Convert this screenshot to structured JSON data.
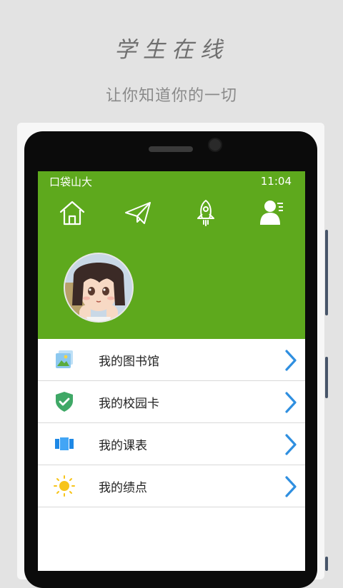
{
  "promo": {
    "title": "学生在线",
    "subtitle": "让你知道你的一切"
  },
  "status_bar": {
    "carrier": "口袋山大",
    "time": "11:04"
  },
  "nav": {
    "icons": [
      "home-icon",
      "paper-plane-icon",
      "rocket-icon",
      "user-profile-icon"
    ]
  },
  "menu": {
    "items": [
      {
        "label": "我的图书馆",
        "icon": "library-picture-icon"
      },
      {
        "label": "我的校园卡",
        "icon": "shield-check-icon"
      },
      {
        "label": "我的课表",
        "icon": "timetable-icon"
      },
      {
        "label": "我的绩点",
        "icon": "sun-icon"
      }
    ]
  },
  "colors": {
    "header_green": "#5ea91d",
    "chevron_blue": "#2f8fe0",
    "background": "#e3e3e3"
  }
}
